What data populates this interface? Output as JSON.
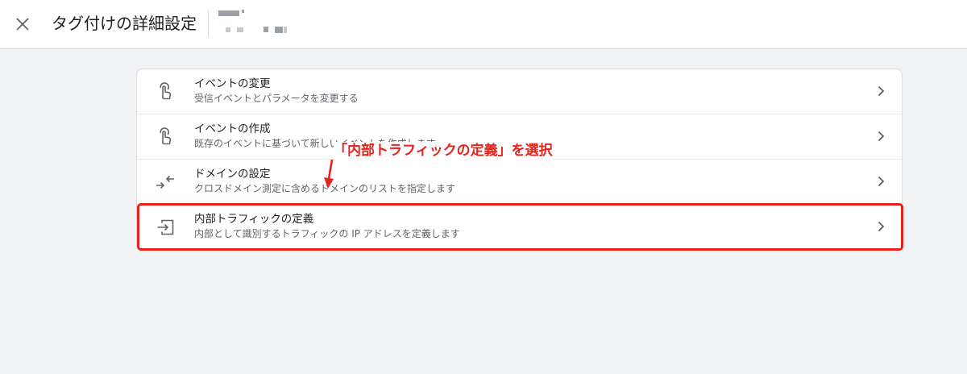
{
  "header": {
    "title": "タグ付けの詳細設定",
    "close_icon": "close-icon",
    "account_name": ""
  },
  "settings": {
    "items": [
      {
        "title": "イベントの変更",
        "description": "受信イベントとパラメータを変更する",
        "icon": "touch-icon"
      },
      {
        "title": "イベントの作成",
        "description": "既存のイベントに基づいて新しいイベントを作成します",
        "icon": "touch-icon"
      },
      {
        "title": "ドメインの設定",
        "description": "クロスドメイン測定に含めるドメインのリストを指定します",
        "icon": "merge-arrows-icon"
      },
      {
        "title": "内部トラフィックの定義",
        "description": "内部として識別するトラフィックの IP アドレスを定義します",
        "icon": "login-icon"
      }
    ]
  },
  "annotation": {
    "text": "「内部トラフィックの定義」を選択",
    "color": "#e5231b"
  },
  "colors": {
    "accent": "#e5231b",
    "background": "#f1f3f4",
    "text_primary": "#202124",
    "text_secondary": "#5f6368"
  }
}
